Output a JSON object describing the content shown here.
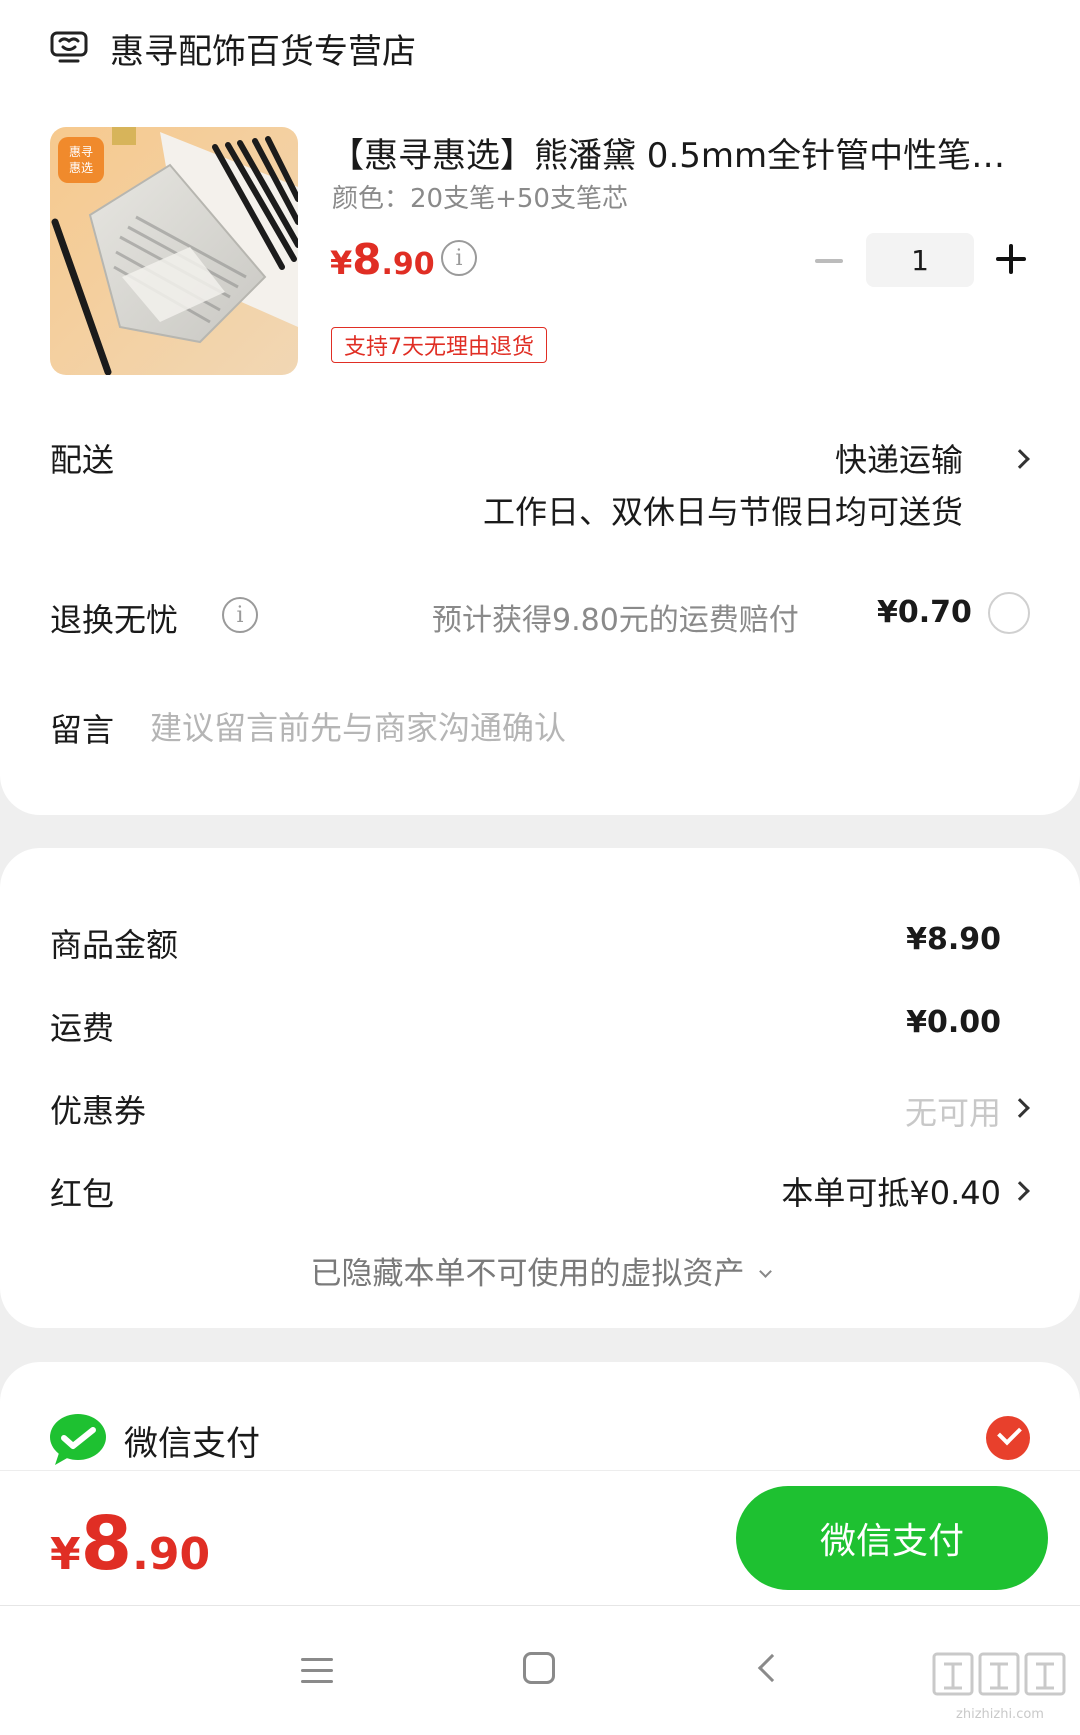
{
  "shop": {
    "name": "惠寻配饰百货专营店",
    "icon": "shop-icon"
  },
  "product": {
    "title": "【惠寻惠选】熊潘黛 0.5mm全针管中性笔…",
    "spec": "颜色：20支笔+50支笔芯",
    "price": {
      "currency": "¥",
      "integer": "8",
      "decimal": ".90"
    },
    "quantity": "1",
    "return_policy": "支持7天无理由退货",
    "image_badge": [
      "惠寻",
      "惠选"
    ]
  },
  "delivery": {
    "label": "配送",
    "method": "快递运输",
    "description": "工作日、双休日与节假日均可送货"
  },
  "return_insurance": {
    "label": "退换无忧",
    "description": "预计获得9.80元的运费赔付",
    "price": "¥0.70"
  },
  "message": {
    "label": "留言",
    "placeholder": "建议留言前先与商家沟通确认"
  },
  "summary": {
    "goods_amount": {
      "label": "商品金额",
      "value": "¥8.90"
    },
    "shipping": {
      "label": "运费",
      "value": "¥0.00"
    },
    "coupon": {
      "label": "优惠券",
      "value": "无可用"
    },
    "red_packet": {
      "label": "红包",
      "value": "本单可抵¥0.40"
    },
    "hidden_assets": "已隐藏本单不可使用的虚拟资产"
  },
  "payment": {
    "method_label": "微信支付",
    "selected": true
  },
  "paybar": {
    "total": {
      "currency": "¥",
      "integer": "8",
      "decimal": ".90"
    },
    "button_label": "微信支付"
  },
  "watermark": "zhizhizhi.com",
  "colors": {
    "price_red": "#e02e24",
    "wechat_green": "#1ec131",
    "check_red": "#e8402c"
  }
}
